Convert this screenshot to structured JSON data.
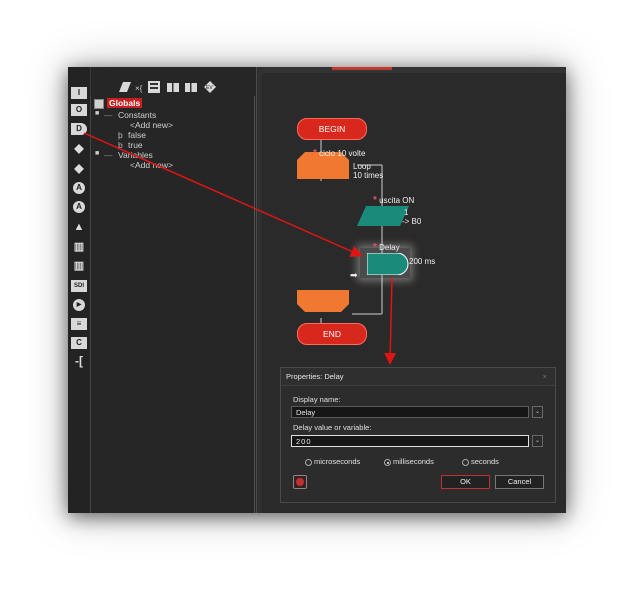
{
  "toolbar": {
    "left_icons": [
      "I",
      "O",
      "D",
      "◆",
      "◆",
      "A",
      "A",
      "▲",
      "▥",
      "▥",
      "SDI",
      "▶",
      "≡",
      "C",
      "-["
    ],
    "top_icons": [
      "parallelogram",
      "x-list",
      "table",
      "grid",
      "grid",
      "ev"
    ]
  },
  "tree": {
    "root": "Globals",
    "constants_label": "Constants",
    "add_new_1": "<Add new>",
    "false_label": "false",
    "true_label": "true",
    "variables_label": "Variables",
    "add_new_2": "<Add new>"
  },
  "flow": {
    "begin": "BEGIN",
    "loop_comment": "ciclo 10 volte",
    "loop_label_1": "Loop",
    "loop_label_2": "10 times",
    "output_comment": "uscita ON",
    "output_value_1": "1",
    "output_value_2": "-> B0",
    "delay_comment": "Delay",
    "delay_value": "200 ms",
    "end": "END"
  },
  "dialog": {
    "title": "Properties: Delay",
    "close": "×",
    "display_name_label": "Display name:",
    "display_name_value": "Delay",
    "delay_label": "Delay value or variable:",
    "delay_value": "200",
    "units": [
      "microseconds",
      "milliseconds",
      "seconds"
    ],
    "selected_unit": "milliseconds",
    "ok": "OK",
    "cancel": "Cancel",
    "dropdown_glyph": "⌄"
  },
  "colors": {
    "terminal": "#d8281e",
    "loop": "#f07830",
    "io": "#1a8a7a",
    "arrow": "#e01414"
  }
}
